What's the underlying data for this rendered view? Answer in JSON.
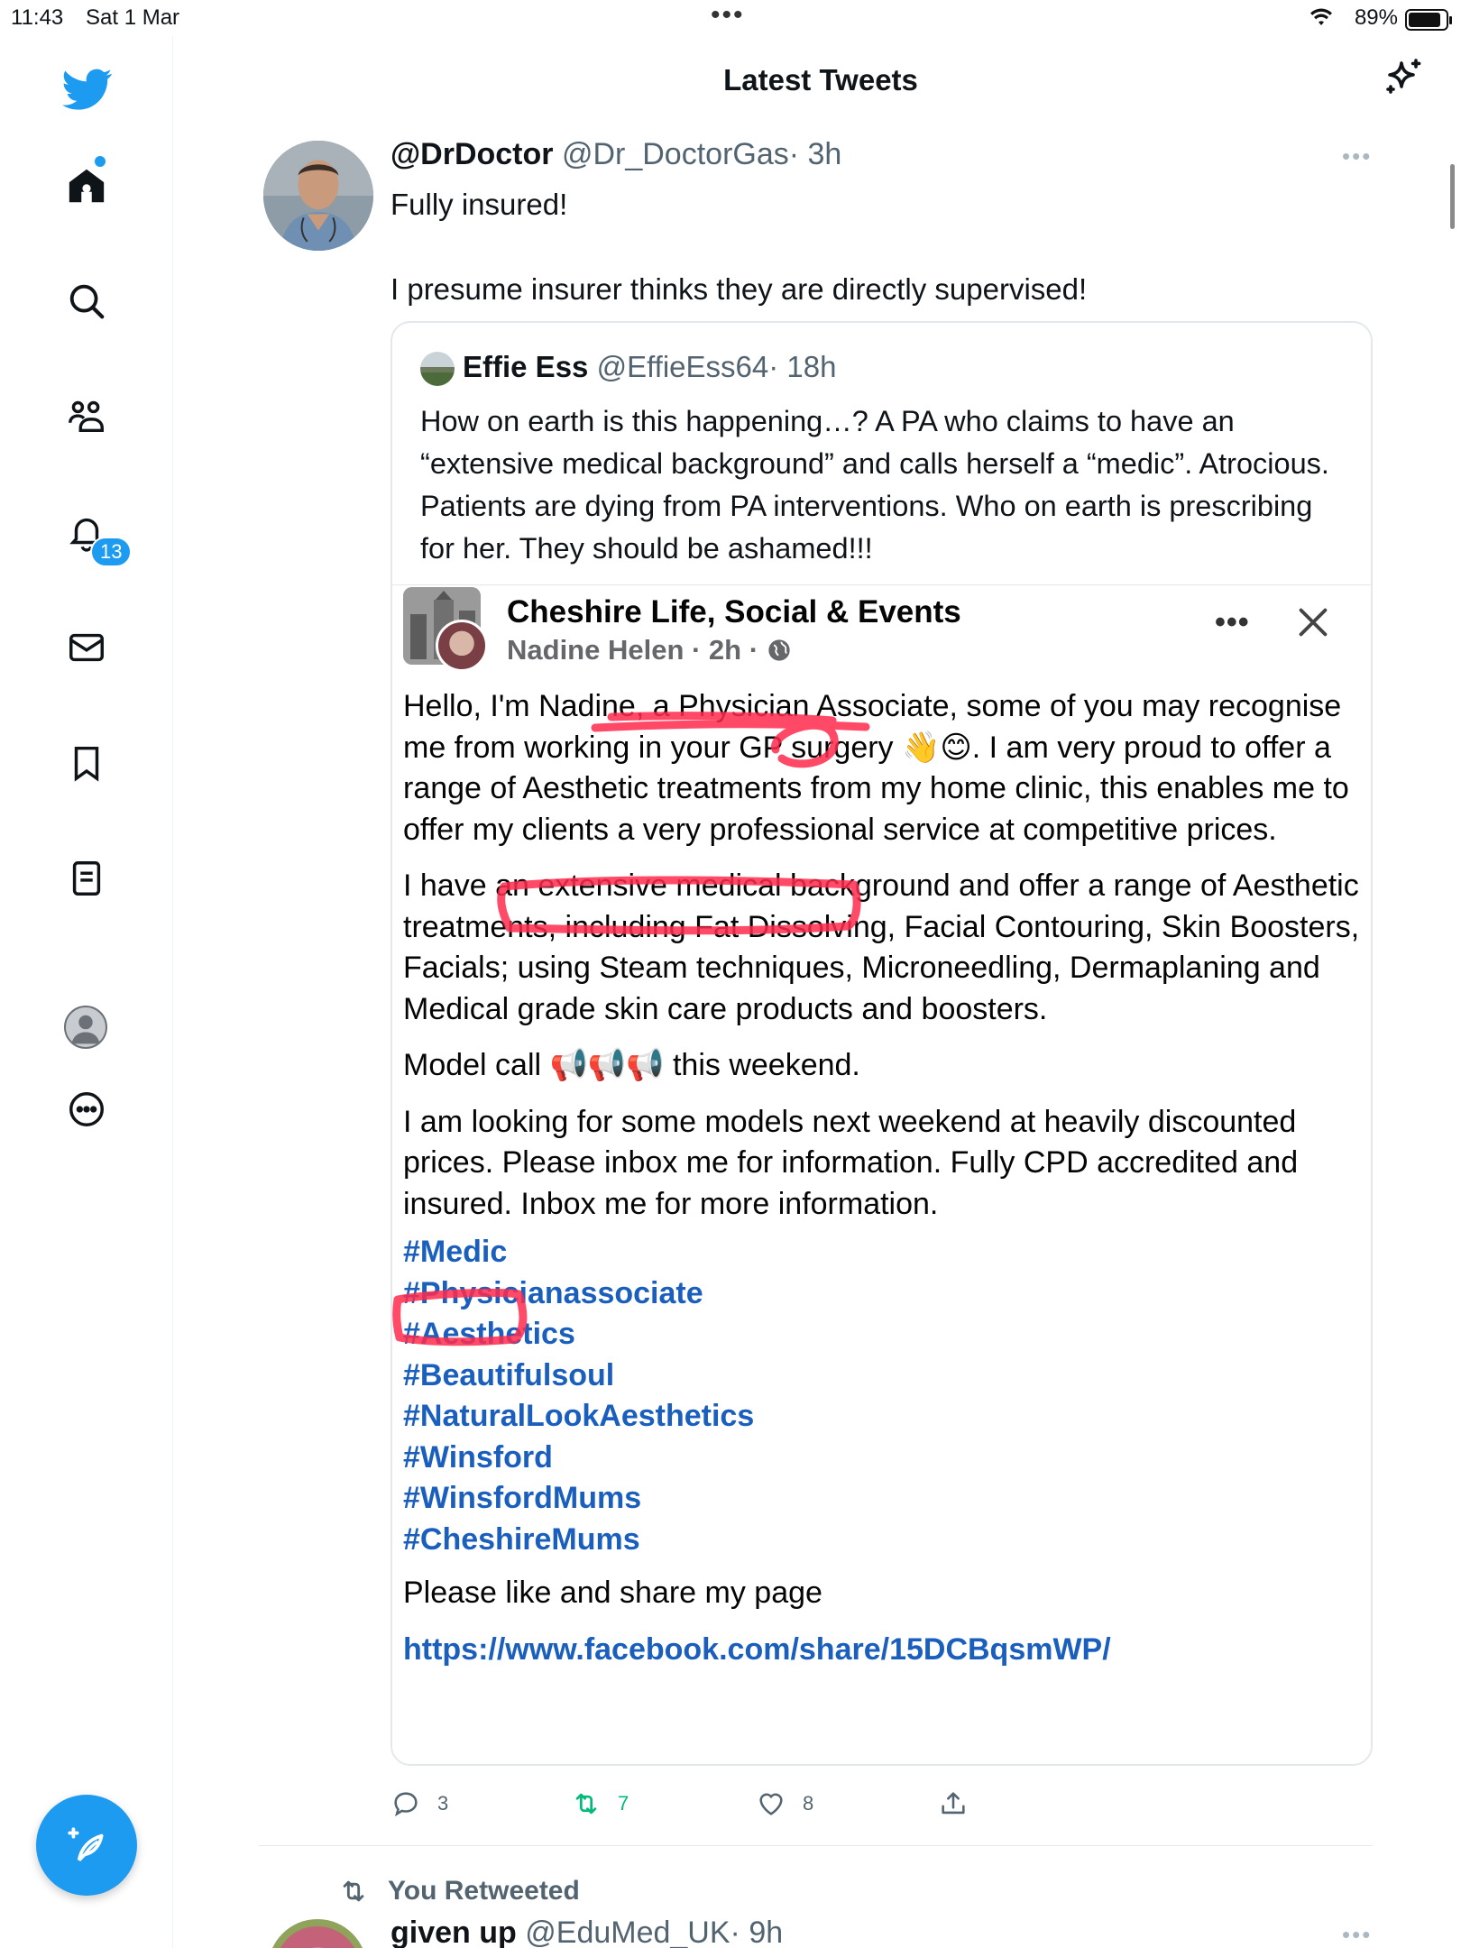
{
  "status_bar": {
    "time": "11:43",
    "date": "Sat 1 Mar",
    "battery": "89%",
    "battery_level": 0.89
  },
  "sidebar": {
    "notifications_count": "13",
    "items": [
      "home",
      "explore",
      "communities",
      "notifications",
      "messages",
      "bookmarks",
      "lists",
      "profile",
      "more"
    ]
  },
  "header": {
    "title": "Latest Tweets"
  },
  "tweet": {
    "name": "@DrDoctor",
    "handle": "@Dr_DoctorGas",
    "time": "· 3h",
    "text": "Fully insured!\n\nI presume insurer thinks they are directly supervised!",
    "replies": "3",
    "retweets": "7",
    "likes": "8"
  },
  "quote": {
    "name": "Effie Ess",
    "handle": "@EffieEss64",
    "time": "· 18h",
    "text": "How on earth is this happening…? A PA who claims to have an “extensive medical background” and calls herself a “medic”. Atrocious. Patients are dying from PA interventions. Who on earth is prescribing for her. They should be ashamed!!!"
  },
  "fb_post": {
    "page": "Cheshire Life, Social & Events",
    "meta": "Nadine Helen · 2h ·",
    "para1": "Hello, I'm Nadine, a Physician Associate, some of you may recognise me from working in your GP surgery 👋😊. I am very proud to offer a range of Aesthetic treatments from my home clinic, this enables me to offer my clients a very professional service at competitive prices.",
    "para2": "I have an extensive medical background and offer a range of Aesthetic treatments, including Fat Dissolving, Facial Contouring, Skin Boosters, Facials; using Steam techniques, Microneedling, Dermaplaning and Medical grade skin care products and boosters.",
    "para3": "Model call 📢📢📢 this weekend.",
    "para4": "I am looking for some models next weekend at heavily discounted prices. Please inbox me for information. Fully CPD accredited and insured. Inbox me for more information.",
    "hashtags": [
      "#Medic",
      "#Physicianassociate",
      "#Aesthetics",
      "#Beautifulsoul",
      "#NaturalLookAesthetics",
      "#Winsford",
      "#WinsfordMums",
      "#CheshireMums"
    ],
    "para5": "Please like and share my page",
    "link": "https://www.facebook.com/share/15DCBqsmWP/"
  },
  "next_tweet": {
    "retweeted_label": "You Retweeted",
    "name": "given up",
    "handle": "@EduMed_UK",
    "time": "· 9h"
  },
  "colors": {
    "accent": "#1d9bf0",
    "retweet": "#00ba7c",
    "link": "#1a5fbd",
    "annotation": "#ff2a4d"
  }
}
